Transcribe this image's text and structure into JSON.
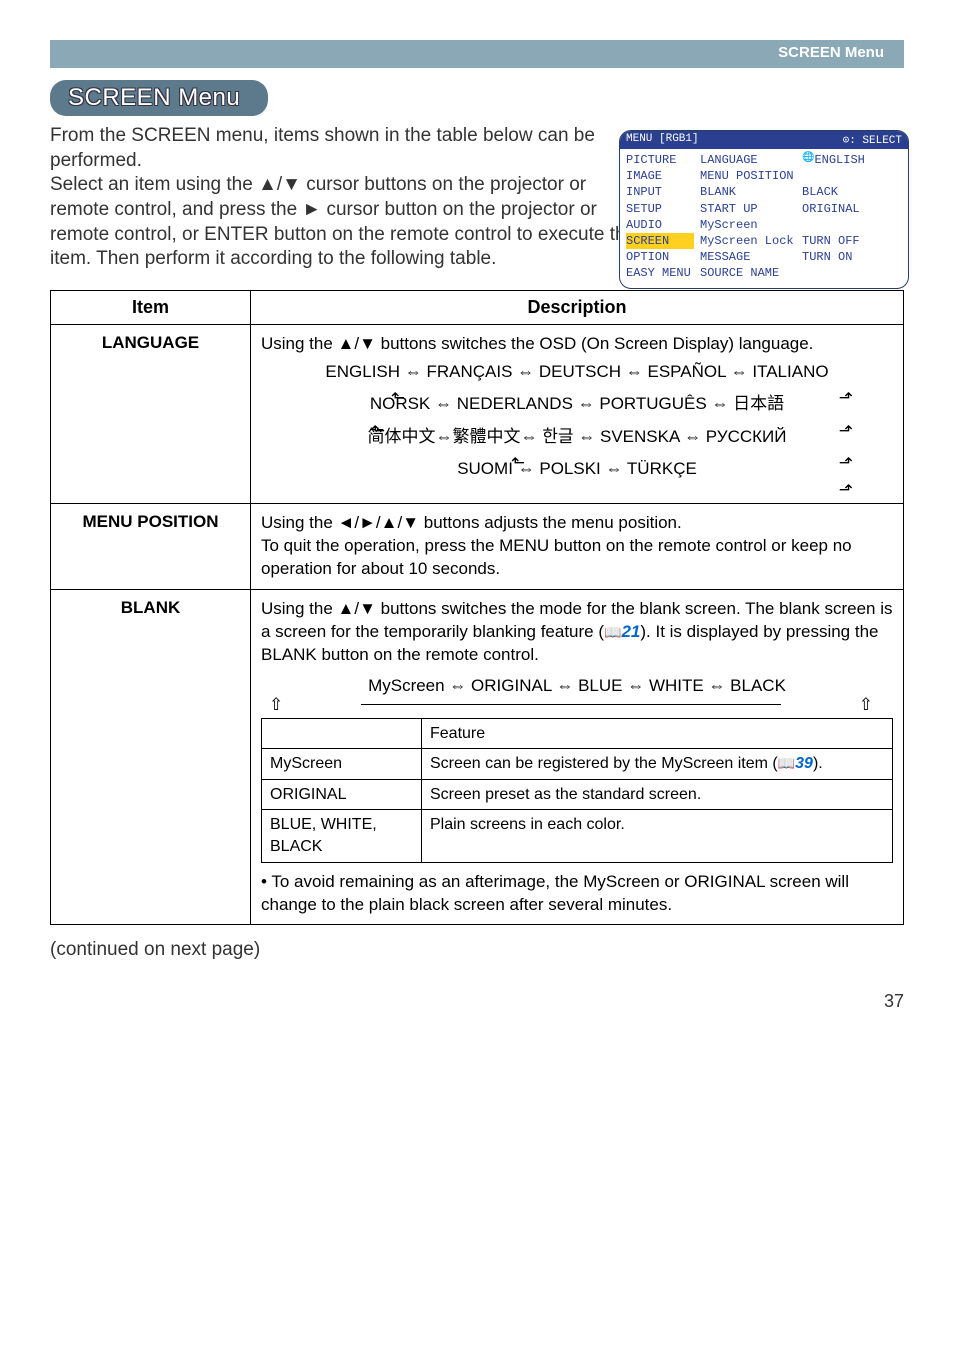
{
  "header": {
    "section_label": "SCREEN Menu",
    "title": "SCREEN Menu"
  },
  "intro": "From the SCREEN menu, items shown in the table below can be performed.\nSelect an item using the ▲/▼ cursor buttons on the projector or remote control, and press the ► cursor button on the projector or remote control, or ENTER button on the remote control to execute the item. Then perform it according to the following table.",
  "mini": {
    "header_left": "MENU [RGB1]",
    "header_right": ": SELECT",
    "left_items": [
      "PICTURE",
      "IMAGE",
      "INPUT",
      "SETUP",
      "AUDIO",
      "SCREEN",
      "OPTION",
      "EASY MENU"
    ],
    "highlight_index": 5,
    "right_rows": [
      {
        "label": "LANGUAGE",
        "value": "",
        "icon": "🌐",
        "extra": "ENGLISH"
      },
      {
        "label": "MENU POSITION",
        "value": ""
      },
      {
        "label": "BLANK",
        "value": "BLACK"
      },
      {
        "label": "START UP",
        "value": "ORIGINAL"
      },
      {
        "label": "MyScreen",
        "value": ""
      },
      {
        "label": "MyScreen Lock",
        "value": "TURN OFF"
      },
      {
        "label": "MESSAGE",
        "value": "TURN ON"
      },
      {
        "label": "SOURCE NAME",
        "value": ""
      }
    ]
  },
  "table": {
    "head_item": "Item",
    "head_desc": "Description",
    "rows": {
      "language": {
        "item": "LANGUAGE",
        "intro": "Using the ▲/▼ buttons switches the OSD (On Screen Display) language.",
        "line1": "ENGLISH ⇔ FRANÇAIS ⇔ DEUTSCH ⇔ ESPAÑOL ⇔ ITALIANO",
        "line2": "NORSK ⇔ NEDERLANDS ⇔ PORTUGUÊS ⇔ 日本語",
        "line3": "简体中文⇔繁體中文⇔ 한글 ⇔ SVENSKA ⇔ РУССКИЙ",
        "line4": "SUOMI ⇔ POLSKI ⇔ TÜRKÇE"
      },
      "menu_position": {
        "item": "MENU POSITION",
        "desc": "Using the ◄/►/▲/▼ buttons adjusts the menu position.\nTo quit the operation, press the MENU button on the remote control or keep no operation for about 10 seconds."
      },
      "blank": {
        "item": "BLANK",
        "p1a": "Using the ▲/▼ buttons switches the mode for the blank screen. The blank screen is a screen for the temporarily blanking feature (",
        "p1_ref": "21",
        "p1b": "). It is displayed by pressing the BLANK button on the remote control.",
        "cycle": "MyScreen ⇔ ORIGINAL ⇔ BLUE ⇔ WHITE ⇔ BLACK",
        "th_feature": "Feature",
        "inner": [
          {
            "k": "MyScreen",
            "v_a": "Screen can be registered by the MyScreen item (",
            "ref": "39",
            "v_b": ")."
          },
          {
            "k": "ORIGINAL",
            "v": "Screen preset as the standard screen."
          },
          {
            "k": "BLUE, WHITE, BLACK",
            "v": "Plain screens in each color."
          }
        ],
        "note": "• To avoid remaining as an afterimage, the MyScreen or ORIGINAL screen will change to the plain black screen after several minutes."
      }
    }
  },
  "continued": "(continued on next page)",
  "page_number": "37"
}
